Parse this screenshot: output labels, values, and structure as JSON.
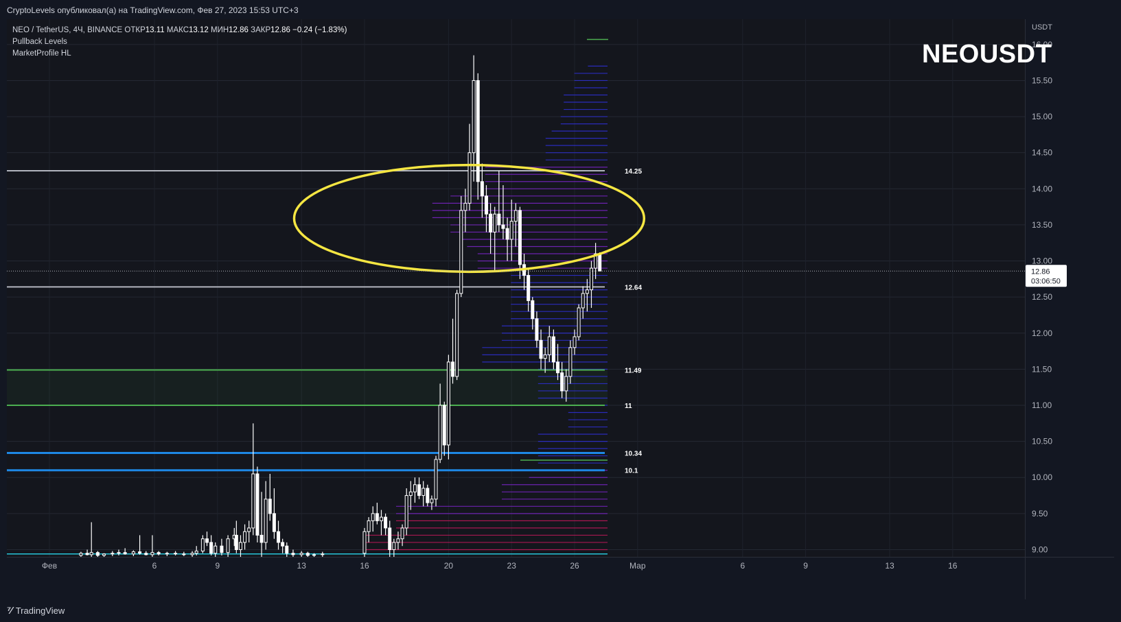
{
  "header": {
    "caption": "CryptoLevels опубликовал(а) на TradingView.com, Фев 27, 2023 15:53 UTC+3"
  },
  "legend": {
    "symbol": "NEO / TetherUS, 4Ч, BINANCE",
    "open_label": "ОТКР",
    "open": "13.11",
    "high_label": "МАКС",
    "high": "13.12",
    "low_label": "МИН",
    "low": "12.86",
    "close_label": "ЗАКР",
    "close": "12.86",
    "change": "−0.24 (−1.83%)",
    "indicators": [
      "Pullback Levels",
      "MarketProfile HL"
    ]
  },
  "watermark": "NEOUSDT",
  "footer": {
    "brand": "TradingView"
  },
  "colors": {
    "background": "#131722",
    "candle": "#ffffff",
    "gray_level": "#b2b5be",
    "green_level": "#4caf50",
    "blue_level": "#1e88e5",
    "ellipse": "#f5e642",
    "profile_blue": "#2e2fd6",
    "profile_purple": "#7b25c8",
    "profile_pink": "#c2185b",
    "cyan_line": "#26c6da"
  },
  "chart_data": {
    "type": "candlestick",
    "title": "NEOUSDT",
    "currency": "USDT",
    "ylim": [
      8.9,
      16.35
    ],
    "y_ticks": [
      "9.00",
      "9.50",
      "10.00",
      "10.50",
      "11.00",
      "11.50",
      "12.00",
      "12.50",
      "13.00",
      "13.50",
      "14.00",
      "14.50",
      "15.00",
      "15.50",
      "16.00"
    ],
    "x_ticks": [
      {
        "label": "Фев",
        "day": 0.0
      },
      {
        "label": "6",
        "day": 5.0
      },
      {
        "label": "9",
        "day": 8.0
      },
      {
        "label": "13",
        "day": 12.0
      },
      {
        "label": "16",
        "day": 15.0
      },
      {
        "label": "20",
        "day": 19.0
      },
      {
        "label": "23",
        "day": 22.0
      },
      {
        "label": "26",
        "day": 25.0
      },
      {
        "label": "Мар",
        "day": 28.0
      },
      {
        "label": "6",
        "day": 33.0
      },
      {
        "label": "9",
        "day": 36.0
      },
      {
        "label": "13",
        "day": 40.0
      },
      {
        "label": "16",
        "day": 43.0
      }
    ],
    "current_price": {
      "label": "12.86",
      "countdown": "03:06:50",
      "value": 12.86
    },
    "levels": [
      {
        "label": "14.25",
        "value": 14.25,
        "color": "#b2b5be",
        "thickness": 2
      },
      {
        "label": "12.64",
        "value": 12.64,
        "color": "#b2b5be",
        "thickness": 2
      },
      {
        "label": "11.49",
        "value": 11.49,
        "color": "#4caf50",
        "thickness": 2
      },
      {
        "label": "11",
        "value": 11.0,
        "color": "#4caf50",
        "thickness": 2
      },
      {
        "label": "10.34",
        "value": 10.34,
        "color": "#1e88e5",
        "thickness": 3
      },
      {
        "label": "10.1",
        "value": 10.1,
        "color": "#1e88e5",
        "thickness": 3
      }
    ],
    "highlight_zone": {
      "from": 11.0,
      "to": 11.49
    },
    "ellipse_zone": {
      "center_day": 19.98,
      "center_price": 13.59,
      "half_width_days": 8.33,
      "half_height_price": 0.74
    },
    "candles": [
      {
        "d": 1.5,
        "o": 8.92,
        "h": 8.97,
        "l": 8.9,
        "c": 8.95
      },
      {
        "d": 1.8,
        "o": 8.95,
        "h": 9.0,
        "l": 8.92,
        "c": 8.93
      },
      {
        "d": 2.0,
        "o": 8.93,
        "h": 9.38,
        "l": 8.9,
        "c": 8.96
      },
      {
        "d": 2.3,
        "o": 8.96,
        "h": 8.98,
        "l": 8.9,
        "c": 8.92
      },
      {
        "d": 2.6,
        "o": 8.92,
        "h": 8.95,
        "l": 8.9,
        "c": 8.94
      },
      {
        "d": 3.0,
        "o": 8.94,
        "h": 8.98,
        "l": 8.91,
        "c": 8.95
      },
      {
        "d": 3.3,
        "o": 8.95,
        "h": 9.0,
        "l": 8.92,
        "c": 8.96
      },
      {
        "d": 3.6,
        "o": 8.96,
        "h": 9.02,
        "l": 8.93,
        "c": 8.94
      },
      {
        "d": 4.0,
        "o": 8.94,
        "h": 8.99,
        "l": 8.91,
        "c": 8.97
      },
      {
        "d": 4.3,
        "o": 8.97,
        "h": 9.2,
        "l": 8.93,
        "c": 8.95
      },
      {
        "d": 4.6,
        "o": 8.95,
        "h": 8.98,
        "l": 8.92,
        "c": 8.93
      },
      {
        "d": 4.9,
        "o": 8.93,
        "h": 9.2,
        "l": 8.9,
        "c": 8.96
      },
      {
        "d": 5.2,
        "o": 8.96,
        "h": 8.98,
        "l": 8.92,
        "c": 8.94
      },
      {
        "d": 5.6,
        "o": 8.94,
        "h": 8.97,
        "l": 8.91,
        "c": 8.95
      },
      {
        "d": 6.0,
        "o": 8.95,
        "h": 8.98,
        "l": 8.92,
        "c": 8.94
      },
      {
        "d": 6.4,
        "o": 8.94,
        "h": 8.97,
        "l": 8.91,
        "c": 8.93
      },
      {
        "d": 6.8,
        "o": 8.93,
        "h": 8.98,
        "l": 8.9,
        "c": 8.95
      },
      {
        "d": 7.0,
        "o": 8.95,
        "h": 9.05,
        "l": 8.92,
        "c": 8.98
      },
      {
        "d": 7.3,
        "o": 8.98,
        "h": 9.2,
        "l": 8.95,
        "c": 9.15
      },
      {
        "d": 7.5,
        "o": 9.15,
        "h": 9.25,
        "l": 9.05,
        "c": 9.1
      },
      {
        "d": 7.7,
        "o": 9.1,
        "h": 9.2,
        "l": 8.92,
        "c": 8.95
      },
      {
        "d": 7.9,
        "o": 8.95,
        "h": 9.1,
        "l": 8.9,
        "c": 9.05
      },
      {
        "d": 8.2,
        "o": 9.05,
        "h": 9.15,
        "l": 8.92,
        "c": 8.96
      },
      {
        "d": 8.5,
        "o": 8.96,
        "h": 9.2,
        "l": 8.9,
        "c": 9.15
      },
      {
        "d": 8.8,
        "o": 9.15,
        "h": 9.3,
        "l": 9.05,
        "c": 9.2
      },
      {
        "d": 8.9,
        "o": 9.2,
        "h": 9.4,
        "l": 8.95,
        "c": 9.0
      },
      {
        "d": 9.1,
        "o": 9.0,
        "h": 9.2,
        "l": 8.9,
        "c": 9.1
      },
      {
        "d": 9.3,
        "o": 9.1,
        "h": 9.35,
        "l": 9.0,
        "c": 9.25
      },
      {
        "d": 9.5,
        "o": 9.25,
        "h": 9.4,
        "l": 9.1,
        "c": 9.3
      },
      {
        "d": 9.7,
        "o": 9.3,
        "h": 10.75,
        "l": 9.2,
        "c": 10.05
      },
      {
        "d": 9.9,
        "o": 10.05,
        "h": 10.15,
        "l": 9.1,
        "c": 9.2
      },
      {
        "d": 10.1,
        "o": 9.2,
        "h": 9.8,
        "l": 8.9,
        "c": 9.1
      },
      {
        "d": 10.3,
        "o": 9.1,
        "h": 9.95,
        "l": 9.0,
        "c": 9.7
      },
      {
        "d": 10.5,
        "o": 9.7,
        "h": 10.05,
        "l": 9.4,
        "c": 9.5
      },
      {
        "d": 10.7,
        "o": 9.5,
        "h": 9.85,
        "l": 9.15,
        "c": 9.25
      },
      {
        "d": 10.9,
        "o": 9.25,
        "h": 9.4,
        "l": 9.0,
        "c": 9.1
      },
      {
        "d": 11.1,
        "o": 9.1,
        "h": 9.15,
        "l": 8.95,
        "c": 9.05
      },
      {
        "d": 11.3,
        "o": 9.05,
        "h": 9.1,
        "l": 8.9,
        "c": 8.95
      },
      {
        "d": 11.6,
        "o": 8.95,
        "h": 9.0,
        "l": 8.9,
        "c": 8.93
      },
      {
        "d": 12.0,
        "o": 8.93,
        "h": 8.98,
        "l": 8.9,
        "c": 8.95
      },
      {
        "d": 12.3,
        "o": 8.95,
        "h": 8.97,
        "l": 8.9,
        "c": 8.92
      },
      {
        "d": 12.6,
        "o": 8.92,
        "h": 8.95,
        "l": 8.9,
        "c": 8.93
      },
      {
        "d": 13.0,
        "o": 8.93,
        "h": 8.97,
        "l": 8.9,
        "c": 8.94
      },
      {
        "d": 15.0,
        "o": 8.95,
        "h": 9.3,
        "l": 8.9,
        "c": 9.25
      },
      {
        "d": 15.2,
        "o": 9.25,
        "h": 9.45,
        "l": 9.1,
        "c": 9.4
      },
      {
        "d": 15.4,
        "o": 9.4,
        "h": 9.6,
        "l": 9.25,
        "c": 9.5
      },
      {
        "d": 15.6,
        "o": 9.5,
        "h": 9.65,
        "l": 9.35,
        "c": 9.4
      },
      {
        "d": 15.8,
        "o": 9.4,
        "h": 9.55,
        "l": 9.2,
        "c": 9.45
      },
      {
        "d": 16.0,
        "o": 9.45,
        "h": 9.5,
        "l": 9.2,
        "c": 9.3
      },
      {
        "d": 16.2,
        "o": 9.3,
        "h": 9.4,
        "l": 8.9,
        "c": 9.0
      },
      {
        "d": 16.4,
        "o": 9.0,
        "h": 9.15,
        "l": 8.9,
        "c": 9.1
      },
      {
        "d": 16.6,
        "o": 9.1,
        "h": 9.25,
        "l": 9.0,
        "c": 9.15
      },
      {
        "d": 16.8,
        "o": 9.15,
        "h": 9.35,
        "l": 9.05,
        "c": 9.3
      },
      {
        "d": 17.0,
        "o": 9.3,
        "h": 9.85,
        "l": 9.2,
        "c": 9.75
      },
      {
        "d": 17.2,
        "o": 9.75,
        "h": 9.95,
        "l": 9.55,
        "c": 9.8
      },
      {
        "d": 17.4,
        "o": 9.8,
        "h": 10.0,
        "l": 9.65,
        "c": 9.9
      },
      {
        "d": 17.6,
        "o": 9.9,
        "h": 10.0,
        "l": 9.7,
        "c": 9.75
      },
      {
        "d": 17.8,
        "o": 9.75,
        "h": 9.95,
        "l": 9.6,
        "c": 9.85
      },
      {
        "d": 18.0,
        "o": 9.85,
        "h": 9.9,
        "l": 9.6,
        "c": 9.65
      },
      {
        "d": 18.2,
        "o": 9.65,
        "h": 9.75,
        "l": 9.55,
        "c": 9.7
      },
      {
        "d": 18.4,
        "o": 9.7,
        "h": 10.3,
        "l": 9.6,
        "c": 10.25
      },
      {
        "d": 18.6,
        "o": 10.25,
        "h": 11.3,
        "l": 10.2,
        "c": 11.0
      },
      {
        "d": 18.8,
        "o": 11.0,
        "h": 11.05,
        "l": 10.3,
        "c": 10.45
      },
      {
        "d": 19.0,
        "o": 10.45,
        "h": 11.7,
        "l": 10.25,
        "c": 11.6
      },
      {
        "d": 19.2,
        "o": 11.6,
        "h": 12.2,
        "l": 11.3,
        "c": 11.4
      },
      {
        "d": 19.4,
        "o": 11.4,
        "h": 12.6,
        "l": 11.35,
        "c": 12.55
      },
      {
        "d": 19.6,
        "o": 12.55,
        "h": 13.9,
        "l": 12.5,
        "c": 13.7
      },
      {
        "d": 19.8,
        "o": 13.7,
        "h": 14.0,
        "l": 13.4,
        "c": 13.8
      },
      {
        "d": 20.0,
        "o": 13.8,
        "h": 14.9,
        "l": 13.7,
        "c": 14.5
      },
      {
        "d": 20.2,
        "o": 14.5,
        "h": 15.85,
        "l": 14.1,
        "c": 15.5
      },
      {
        "d": 20.4,
        "o": 15.5,
        "h": 15.6,
        "l": 13.85,
        "c": 14.1
      },
      {
        "d": 20.6,
        "o": 14.1,
        "h": 14.35,
        "l": 13.6,
        "c": 13.9
      },
      {
        "d": 20.8,
        "o": 13.9,
        "h": 14.05,
        "l": 13.4,
        "c": 13.65
      },
      {
        "d": 21.0,
        "o": 13.65,
        "h": 13.8,
        "l": 13.1,
        "c": 13.4
      },
      {
        "d": 21.2,
        "o": 13.4,
        "h": 13.75,
        "l": 12.85,
        "c": 13.65
      },
      {
        "d": 21.4,
        "o": 13.65,
        "h": 14.25,
        "l": 13.4,
        "c": 13.5
      },
      {
        "d": 21.6,
        "o": 13.5,
        "h": 14.05,
        "l": 13.3,
        "c": 13.45
      },
      {
        "d": 21.8,
        "o": 13.45,
        "h": 13.6,
        "l": 13.0,
        "c": 13.3
      },
      {
        "d": 22.0,
        "o": 13.3,
        "h": 13.85,
        "l": 13.0,
        "c": 13.55
      },
      {
        "d": 22.2,
        "o": 13.55,
        "h": 13.8,
        "l": 13.2,
        "c": 13.7
      },
      {
        "d": 22.4,
        "o": 13.7,
        "h": 13.75,
        "l": 12.75,
        "c": 12.95
      },
      {
        "d": 22.6,
        "o": 12.95,
        "h": 13.1,
        "l": 12.6,
        "c": 12.8
      },
      {
        "d": 22.8,
        "o": 12.8,
        "h": 12.9,
        "l": 12.3,
        "c": 12.45
      },
      {
        "d": 23.0,
        "o": 12.45,
        "h": 12.5,
        "l": 12.05,
        "c": 12.2
      },
      {
        "d": 23.2,
        "o": 12.2,
        "h": 12.3,
        "l": 11.8,
        "c": 11.9
      },
      {
        "d": 23.4,
        "o": 11.9,
        "h": 12.05,
        "l": 11.5,
        "c": 11.65
      },
      {
        "d": 23.6,
        "o": 11.65,
        "h": 11.8,
        "l": 11.45,
        "c": 11.7
      },
      {
        "d": 23.8,
        "o": 11.7,
        "h": 12.1,
        "l": 11.6,
        "c": 11.95
      },
      {
        "d": 24.0,
        "o": 11.95,
        "h": 12.05,
        "l": 11.5,
        "c": 11.6
      },
      {
        "d": 24.2,
        "o": 11.6,
        "h": 11.85,
        "l": 11.35,
        "c": 11.45
      },
      {
        "d": 24.4,
        "o": 11.45,
        "h": 11.6,
        "l": 11.1,
        "c": 11.2
      },
      {
        "d": 24.6,
        "o": 11.2,
        "h": 11.5,
        "l": 11.05,
        "c": 11.4
      },
      {
        "d": 24.8,
        "o": 11.4,
        "h": 11.9,
        "l": 11.3,
        "c": 11.8
      },
      {
        "d": 25.0,
        "o": 11.8,
        "h": 12.05,
        "l": 11.7,
        "c": 11.95
      },
      {
        "d": 25.2,
        "o": 11.95,
        "h": 12.4,
        "l": 11.9,
        "c": 12.35
      },
      {
        "d": 25.4,
        "o": 12.35,
        "h": 12.65,
        "l": 12.2,
        "c": 12.55
      },
      {
        "d": 25.6,
        "o": 12.55,
        "h": 12.75,
        "l": 12.3,
        "c": 12.6
      },
      {
        "d": 25.8,
        "o": 12.6,
        "h": 13.0,
        "l": 12.35,
        "c": 12.9
      },
      {
        "d": 26.0,
        "o": 12.9,
        "h": 13.25,
        "l": 12.75,
        "c": 13.1
      },
      {
        "d": 26.2,
        "o": 13.1,
        "h": 13.12,
        "l": 12.86,
        "c": 12.86
      }
    ],
    "volume_profile": [
      {
        "p": 15.7,
        "len": 1.3,
        "c": "blue"
      },
      {
        "p": 15.6,
        "len": 2.2,
        "c": "blue"
      },
      {
        "p": 15.5,
        "len": 2.2,
        "c": "blue"
      },
      {
        "p": 15.4,
        "len": 2.2,
        "c": "blue"
      },
      {
        "p": 15.3,
        "len": 2.9,
        "c": "blue"
      },
      {
        "p": 15.2,
        "len": 2.9,
        "c": "blue"
      },
      {
        "p": 15.1,
        "len": 2.9,
        "c": "blue"
      },
      {
        "p": 15.0,
        "len": 3.1,
        "c": "blue"
      },
      {
        "p": 14.9,
        "len": 3.1,
        "c": "blue"
      },
      {
        "p": 14.8,
        "len": 3.7,
        "c": "blue"
      },
      {
        "p": 14.7,
        "len": 4.1,
        "c": "blue"
      },
      {
        "p": 14.6,
        "len": 4.1,
        "c": "blue"
      },
      {
        "p": 14.5,
        "len": 4.1,
        "c": "blue"
      },
      {
        "p": 14.4,
        "len": 4.1,
        "c": "blue"
      },
      {
        "p": 14.3,
        "len": 8.1,
        "c": "purple"
      },
      {
        "p": 14.2,
        "len": 8.1,
        "c": "purple"
      },
      {
        "p": 14.1,
        "len": 8.1,
        "c": "purple"
      },
      {
        "p": 14.0,
        "len": 8.1,
        "c": "purple"
      },
      {
        "p": 13.9,
        "len": 10.4,
        "c": "purple"
      },
      {
        "p": 13.8,
        "len": 11.6,
        "c": "purple"
      },
      {
        "p": 13.7,
        "len": 11.6,
        "c": "purple"
      },
      {
        "p": 13.6,
        "len": 11.6,
        "c": "purple"
      },
      {
        "p": 13.5,
        "len": 10.4,
        "c": "purple"
      },
      {
        "p": 13.4,
        "len": 10.4,
        "c": "purple"
      },
      {
        "p": 13.3,
        "len": 9.6,
        "c": "purple"
      },
      {
        "p": 13.2,
        "len": 9.3,
        "c": "purple"
      },
      {
        "p": 13.1,
        "len": 8.6,
        "c": "purple"
      },
      {
        "p": 13.0,
        "len": 8.6,
        "c": "purple"
      },
      {
        "p": 12.9,
        "len": 8.6,
        "c": "purple"
      },
      {
        "p": 12.8,
        "len": 6.4,
        "c": "blue"
      },
      {
        "p": 12.7,
        "len": 6.4,
        "c": "blue"
      },
      {
        "p": 12.6,
        "len": 6.4,
        "c": "blue"
      },
      {
        "p": 12.5,
        "len": 6.4,
        "c": "blue"
      },
      {
        "p": 12.4,
        "len": 6.4,
        "c": "blue"
      },
      {
        "p": 12.3,
        "len": 6.4,
        "c": "blue"
      },
      {
        "p": 12.2,
        "len": 6.4,
        "c": "blue"
      },
      {
        "p": 12.1,
        "len": 7.0,
        "c": "blue"
      },
      {
        "p": 12.0,
        "len": 7.0,
        "c": "blue"
      },
      {
        "p": 11.9,
        "len": 7.0,
        "c": "blue"
      },
      {
        "p": 11.8,
        "len": 8.3,
        "c": "blue"
      },
      {
        "p": 11.7,
        "len": 8.3,
        "c": "blue"
      },
      {
        "p": 11.6,
        "len": 8.3,
        "c": "blue"
      },
      {
        "p": 11.5,
        "len": 4.6,
        "c": "blue"
      },
      {
        "p": 11.4,
        "len": 4.6,
        "c": "blue"
      },
      {
        "p": 11.3,
        "len": 4.6,
        "c": "blue"
      },
      {
        "p": 11.2,
        "len": 4.6,
        "c": "blue"
      },
      {
        "p": 11.1,
        "len": 4.6,
        "c": "blue"
      },
      {
        "p": 11.0,
        "len": 2.9,
        "c": "blue"
      },
      {
        "p": 10.9,
        "len": 2.6,
        "c": "blue"
      },
      {
        "p": 10.8,
        "len": 2.6,
        "c": "blue"
      },
      {
        "p": 10.7,
        "len": 2.6,
        "c": "blue"
      },
      {
        "p": 10.6,
        "len": 4.6,
        "c": "blue"
      },
      {
        "p": 10.5,
        "len": 4.6,
        "c": "blue"
      },
      {
        "p": 10.4,
        "len": 4.6,
        "c": "blue"
      },
      {
        "p": 10.3,
        "len": 4.6,
        "c": "blue"
      },
      {
        "p": 10.2,
        "len": 4.6,
        "c": "blue"
      },
      {
        "p": 10.1,
        "len": 5.2,
        "c": "purple"
      },
      {
        "p": 10.0,
        "len": 5.2,
        "c": "purple"
      },
      {
        "p": 9.9,
        "len": 7.0,
        "c": "purple"
      },
      {
        "p": 9.8,
        "len": 7.0,
        "c": "purple"
      },
      {
        "p": 9.7,
        "len": 7.0,
        "c": "purple"
      },
      {
        "p": 9.6,
        "len": 14.0,
        "c": "purple"
      },
      {
        "p": 9.5,
        "len": 14.0,
        "c": "purple"
      },
      {
        "p": 9.4,
        "len": 14.0,
        "c": "pink"
      },
      {
        "p": 9.3,
        "len": 14.0,
        "c": "pink"
      },
      {
        "p": 9.2,
        "len": 16.2,
        "c": "pink"
      },
      {
        "p": 9.1,
        "len": 16.2,
        "c": "pink"
      },
      {
        "p": 9.0,
        "len": 16.2,
        "c": "pink"
      }
    ]
  }
}
